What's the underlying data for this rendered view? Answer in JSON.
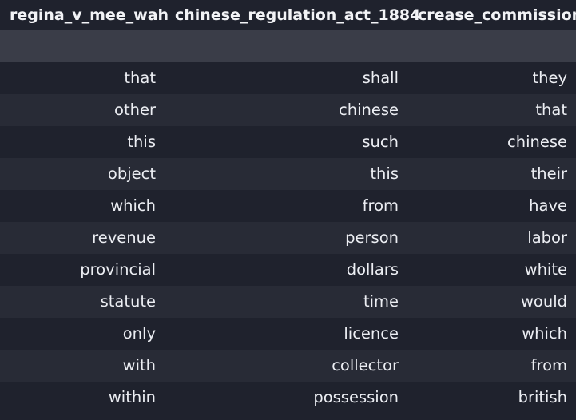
{
  "table": {
    "columns": [
      "regina_v_mee_wah",
      "chinese_regulation_act_1884",
      "crease_commission"
    ],
    "rows": [
      [
        "that",
        "shall",
        "they"
      ],
      [
        "other",
        "chinese",
        "that"
      ],
      [
        "this",
        "such",
        "chinese"
      ],
      [
        "object",
        "this",
        "their"
      ],
      [
        "which",
        "from",
        "have"
      ],
      [
        "revenue",
        "person",
        "labor"
      ],
      [
        "provincial",
        "dollars",
        "white"
      ],
      [
        "statute",
        "time",
        "would"
      ],
      [
        "only",
        "licence",
        "which"
      ],
      [
        "with",
        "collector",
        "from"
      ],
      [
        "within",
        "possession",
        "british"
      ]
    ]
  }
}
